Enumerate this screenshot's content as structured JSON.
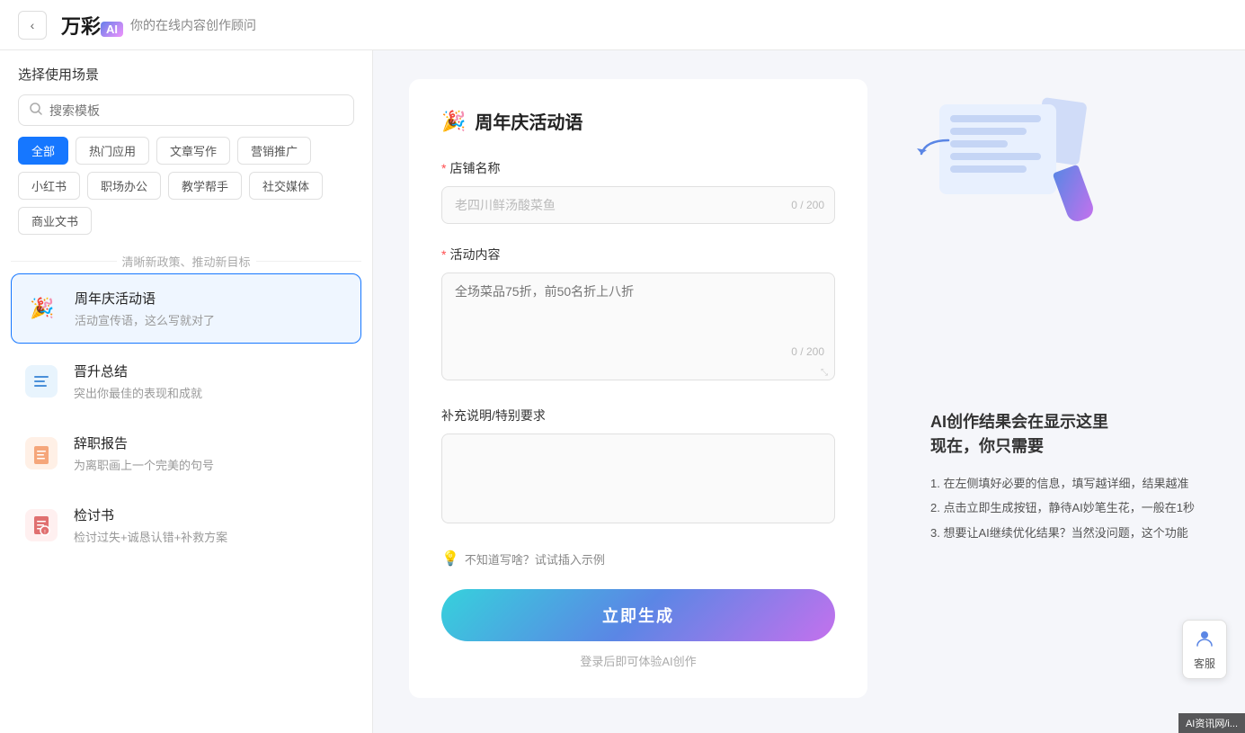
{
  "header": {
    "back_label": "‹",
    "logo_main": "万彩",
    "logo_ai": "AI",
    "subtitle": "你的在线内容创作顾问"
  },
  "sidebar": {
    "title": "选择使用场景",
    "search_placeholder": "搜索模板",
    "tags": [
      {
        "label": "全部",
        "active": true
      },
      {
        "label": "热门应用",
        "active": false
      },
      {
        "label": "文章写作",
        "active": false
      },
      {
        "label": "营销推广",
        "active": false
      },
      {
        "label": "小红书",
        "active": false
      },
      {
        "label": "职场办公",
        "active": false
      },
      {
        "label": "教学帮手",
        "active": false
      },
      {
        "label": "社交媒体",
        "active": false
      },
      {
        "label": "商业文书",
        "active": false
      }
    ],
    "section_label": "清晰新政策、推动新目标",
    "templates": [
      {
        "id": "anniversary",
        "icon": "🎉",
        "name": "周年庆活动语",
        "desc": "活动宣传语，这么写就对了",
        "active": true
      },
      {
        "id": "promotion",
        "icon": "📋",
        "name": "晋升总结",
        "desc": "突出你最佳的表现和成就",
        "active": false
      },
      {
        "id": "resignation",
        "icon": "📝",
        "name": "辞职报告",
        "desc": "为离职画上一个完美的句号",
        "active": false
      },
      {
        "id": "review",
        "icon": "📑",
        "name": "检讨书",
        "desc": "检讨过失+诚恳认错+补救方案",
        "active": false
      }
    ]
  },
  "form": {
    "title": "周年庆活动语",
    "title_icon": "🎉",
    "fields": [
      {
        "id": "store_name",
        "label": "店铺名称",
        "required": true,
        "placeholder": "老四川鲜汤酸菜鱼",
        "type": "input",
        "char_count": "0 / 200"
      },
      {
        "id": "activity_content",
        "label": "活动内容",
        "required": true,
        "placeholder": "全场菜品75折，前50名折上八折",
        "type": "textarea",
        "char_count": "0 / 200"
      },
      {
        "id": "extra",
        "label": "补充说明/特别要求",
        "required": false,
        "placeholder": "",
        "type": "textarea",
        "char_count": ""
      }
    ],
    "hint_icon": "💡",
    "hint_text": "不知道写啥？试试插入示例",
    "generate_btn": "立即生成",
    "login_hint": "登录后即可体验AI创作"
  },
  "right_panel": {
    "ai_title": "AI创作结果会在显示这里\n现在，你只需要",
    "steps": [
      "1. 在左侧填好必要的信息，填写越详细，结果越准",
      "2. 点击立即生成按钮，静待AI妙笔生花，一般在1秒",
      "3. 想要让AI继续优化结果？当然没问题，这个功能"
    ]
  },
  "customer_service": {
    "icon": "👨‍💼",
    "label": "客服"
  },
  "watermark": {
    "text": "AI资讯网/i..."
  }
}
